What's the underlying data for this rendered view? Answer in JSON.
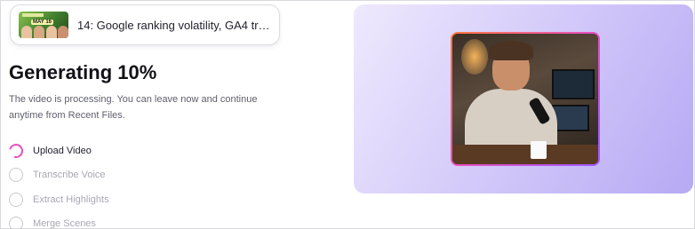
{
  "video": {
    "thumbnail_date": "MAY 16",
    "title": "14: Google ranking volatility, GA4 tracks AI t..."
  },
  "status": {
    "heading": "Generating 10%",
    "progress_percent": 10,
    "description": "The video is processing. You can leave now and continue anytime from Recent Files."
  },
  "steps": [
    {
      "label": "Upload Video",
      "state": "in-progress"
    },
    {
      "label": "Transcribe Voice",
      "state": "pending"
    },
    {
      "label": "Extract Highlights",
      "state": "pending"
    },
    {
      "label": "Merge Scenes",
      "state": "pending"
    }
  ],
  "colors": {
    "accent": "#e84fc0",
    "panel_gradient_start": "#eee9fd",
    "panel_gradient_end": "#b7a9f4",
    "pending_text": "#a8a8b2"
  },
  "icons": {
    "active_step": "loading-spinner-icon",
    "pending_step": "empty-circle-icon"
  }
}
